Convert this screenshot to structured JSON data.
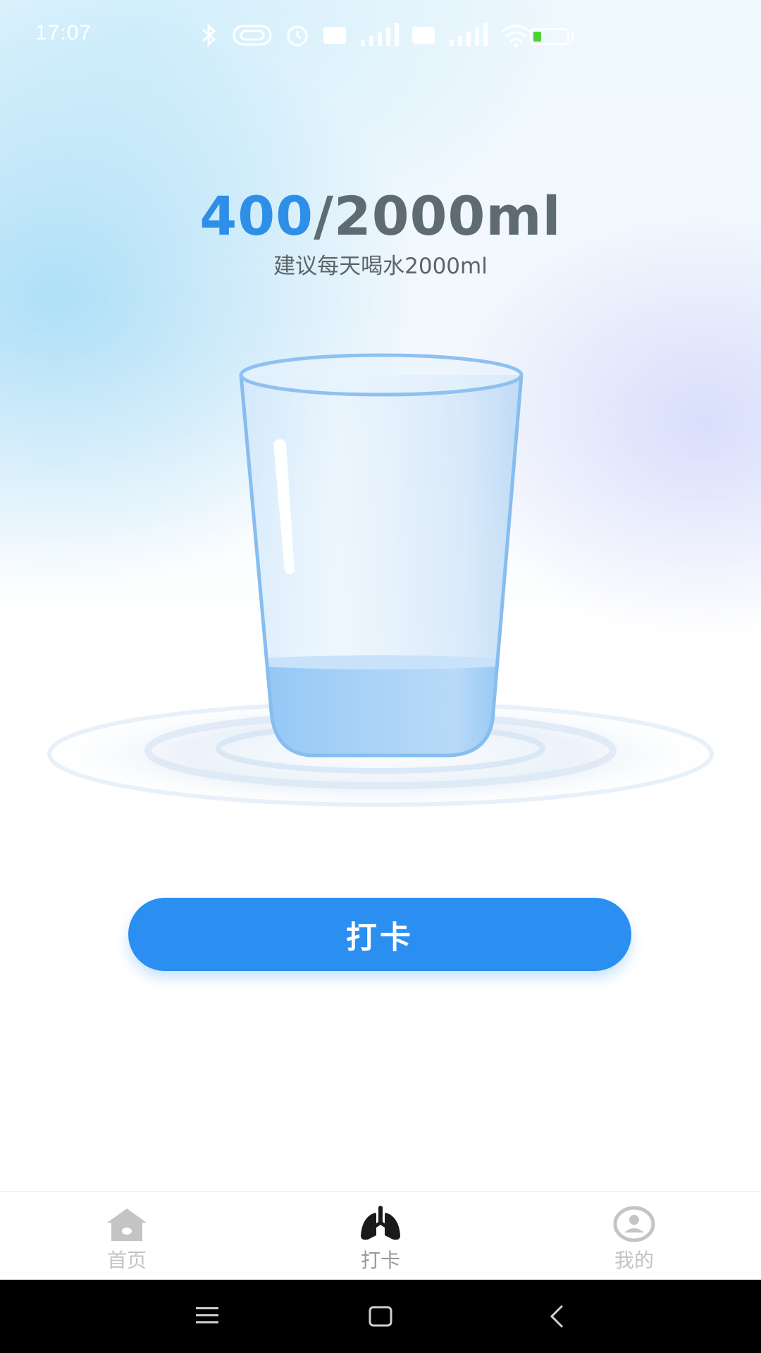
{
  "status_bar": {
    "time": "17:07",
    "icons": [
      "bluetooth-icon",
      "nfc-icon",
      "alarm-icon",
      "hd-icon",
      "signal-icon",
      "hd-icon",
      "signal-icon",
      "wifi-icon",
      "battery-icon"
    ],
    "battery_color": "#4cd137"
  },
  "water": {
    "current": "400",
    "separator": "/",
    "goal": "2000ml",
    "hint": "建议每天喝水2000ml",
    "fill_fraction": 0.2,
    "accent_color": "#2e8fe8"
  },
  "actions": {
    "punch_label": "打卡",
    "button_color": "#2a8ff1"
  },
  "tab_bar": {
    "items": [
      {
        "label": "首页",
        "icon": "home-icon"
      },
      {
        "label": "打卡",
        "icon": "lungs-icon",
        "active": true
      },
      {
        "label": "我的",
        "icon": "profile-icon"
      }
    ]
  },
  "system_nav": {
    "icons": [
      "menu-icon",
      "home-square-icon",
      "back-icon"
    ]
  }
}
